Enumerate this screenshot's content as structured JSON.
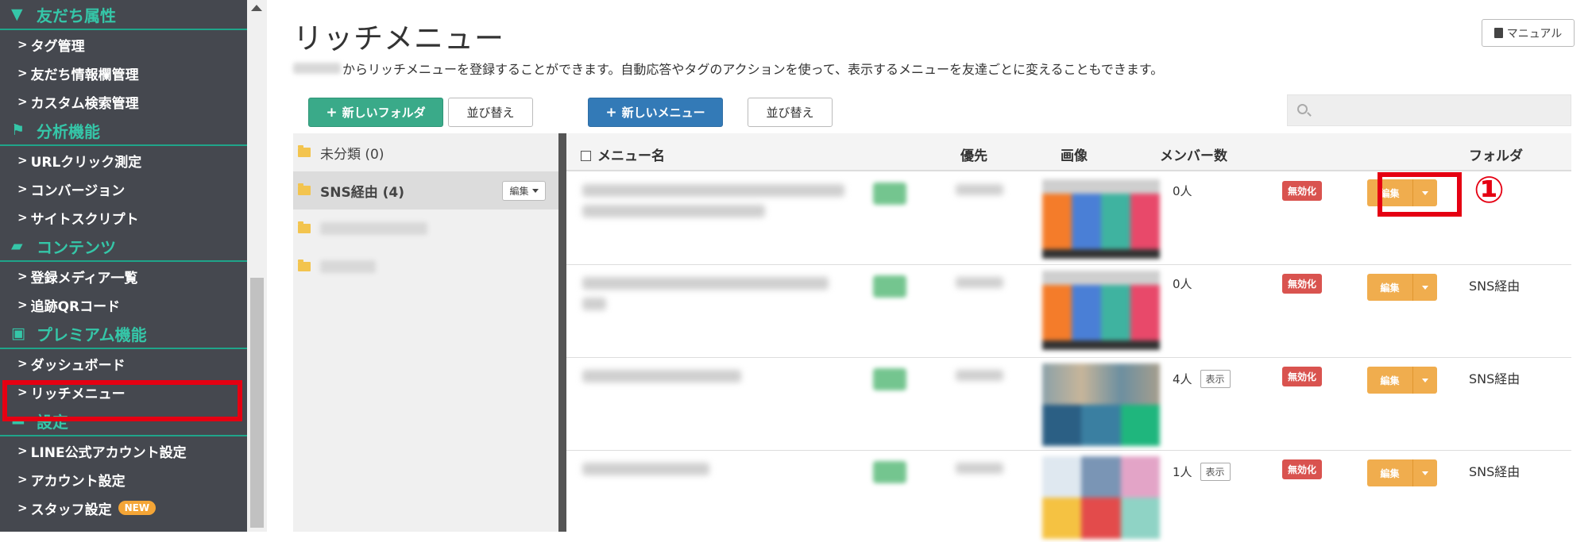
{
  "sidebar": {
    "sections": [
      {
        "title": "友だち属性",
        "icon": "filter-icon",
        "items": [
          "タグ管理",
          "友だち情報欄管理",
          "カスタム検索管理"
        ]
      },
      {
        "title": "分析機能",
        "icon": "flag-icon",
        "items": [
          "URLクリック測定",
          "コンバージョン",
          "サイトスクリプト"
        ]
      },
      {
        "title": "コンテンツ",
        "icon": "folder-open-icon",
        "items": [
          "登録メディア一覧",
          "追跡QRコード"
        ]
      },
      {
        "title": "プレミアム機能",
        "icon": "gift-icon",
        "items": [
          "ダッシュボード",
          "リッチメニュー"
        ]
      },
      {
        "title": "設定",
        "icon": "comment-icon",
        "items": [
          "LINE公式アカウント設定",
          "アカウント設定",
          "スタッフ設定"
        ]
      }
    ],
    "new_badge": "NEW",
    "highlight_color": "#e50012",
    "accent_color": "#35c6a8"
  },
  "page": {
    "title": "リッチメニュー",
    "description": "からリッチメニューを登録することができます。自動応答やタグのアクションを使って、表示するメニューを友達ごとに変えることもできます。",
    "manual_label": "マニュアル"
  },
  "toolbar": {
    "new_folder_label": "新しいフォルダ",
    "sort_label": "並び替え",
    "new_menu_label": "新しいメニュー",
    "menu_sort_label": "並び替え"
  },
  "folders": {
    "items": [
      {
        "label": "未分類 (0)"
      },
      {
        "label": "SNS経由 (4)",
        "edit_label": "編集"
      }
    ]
  },
  "table": {
    "headers": {
      "name": "メニュー名",
      "priority": "優先",
      "image": "画像",
      "members": "メンバー数",
      "folder": "フォルダ"
    },
    "rows": [
      {
        "members": "0人",
        "status": "無効化",
        "edit": "編集",
        "folder": ""
      },
      {
        "members": "0人",
        "status": "無効化",
        "edit": "編集",
        "folder": "SNS経由"
      },
      {
        "members": "4人",
        "show": "表示",
        "status": "無効化",
        "edit": "編集",
        "folder": "SNS経由"
      },
      {
        "members": "1人",
        "show": "表示",
        "status": "無効化",
        "edit": "編集",
        "folder": "SNS経由"
      }
    ]
  },
  "annotation": {
    "step": "①"
  }
}
